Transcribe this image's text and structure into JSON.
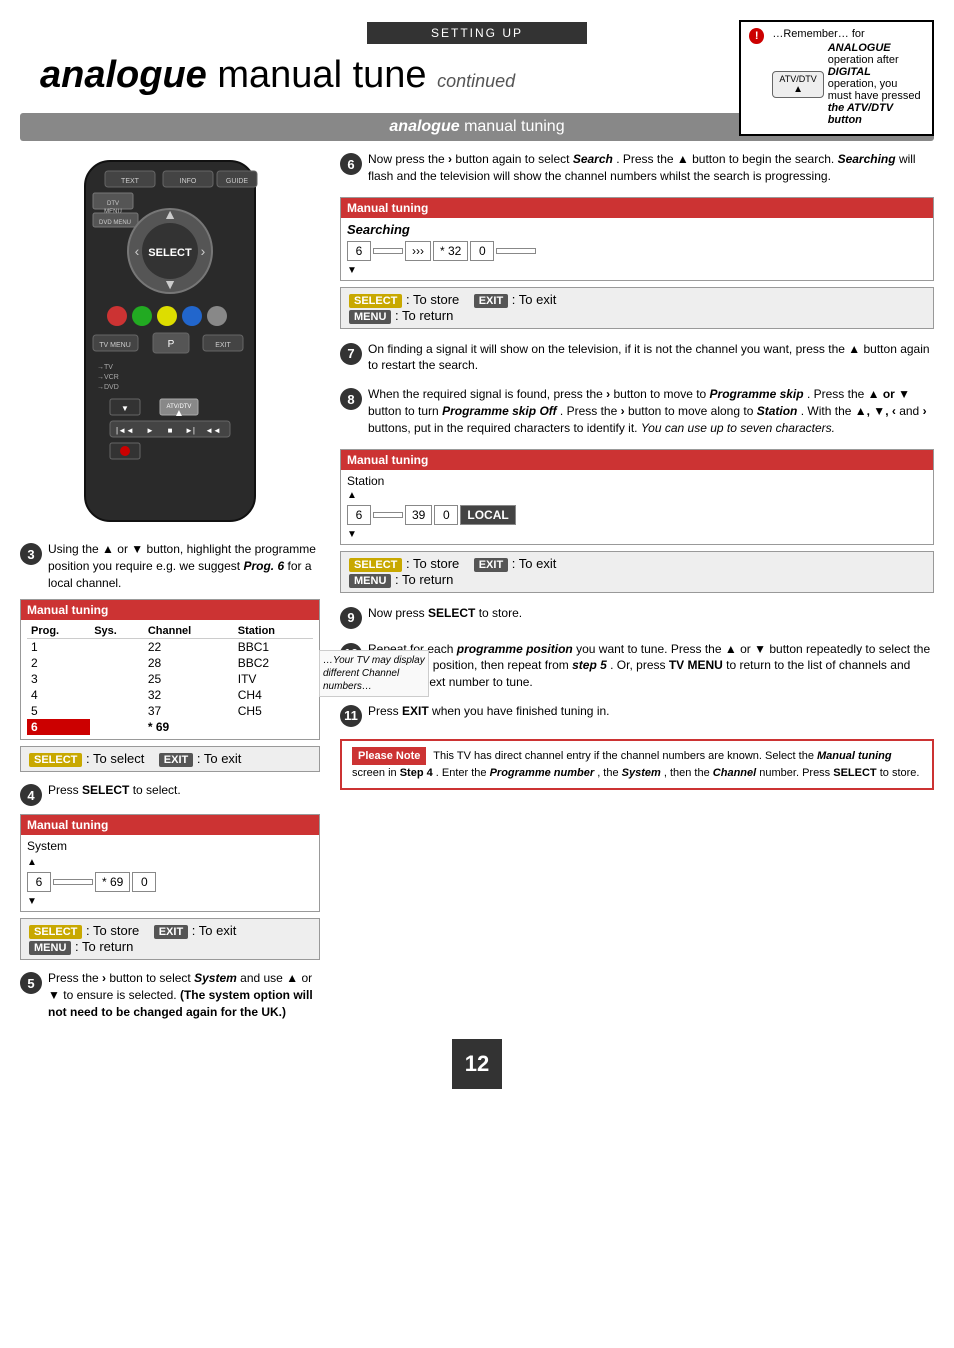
{
  "header": {
    "bar_label": "SETTING UP",
    "title_bold": "analogue",
    "title_regular": " manual tune",
    "title_continued": " continued"
  },
  "remember_box": {
    "exclaim": "!",
    "line1": "…Remember… for",
    "line2": "ANALOGUE",
    "line3": "operation after",
    "line4": "DIGITAL",
    "line5": "operation, you",
    "line6": "must have pressed",
    "line7": "the ATV/DTV button",
    "atv_label": "ATV/DTV",
    "btn_symbol": "▲"
  },
  "section_header": {
    "bold": "analogue",
    "regular": " manual tuning"
  },
  "step3": {
    "number": "3",
    "text": "Using the",
    "up_arrow": "▲",
    "or": " or ",
    "down_arrow": "▼",
    "text2": " button, highlight the programme position you require e.g. we suggest ",
    "prog_bold": "Prog. 6",
    "text3": " for a local channel.",
    "table_header": "Manual tuning",
    "col_prog": "Prog.",
    "col_sys": "Sys.",
    "col_channel": "Channel",
    "col_station": "Station",
    "rows": [
      {
        "prog": "1",
        "sys": "",
        "channel": "22",
        "station": "BBC1"
      },
      {
        "prog": "2",
        "sys": "",
        "channel": "28",
        "station": "BBC2"
      },
      {
        "prog": "3",
        "sys": "",
        "channel": "25",
        "station": "ITV"
      },
      {
        "prog": "4",
        "sys": "",
        "channel": "32",
        "station": "CH4"
      },
      {
        "prog": "5",
        "sys": "",
        "channel": "37",
        "station": "CH5"
      },
      {
        "prog": "6",
        "sys": "",
        "channel": "* 69",
        "station": ""
      }
    ],
    "select_label": "SELECT",
    "select_action": ": To select",
    "exit_label": "EXIT",
    "exit_action": ": To exit",
    "tv_note": "…Your TV may display different Channel numbers…"
  },
  "step4": {
    "number": "4",
    "text": "Press ",
    "select_bold": "SELECT",
    "text2": " to select.",
    "table_header": "Manual tuning",
    "section_label": "System",
    "ch_val1": "6",
    "ch_val2": "* 69",
    "ch_val3": "0",
    "select_label": "SELECT",
    "select_action": ": To store",
    "exit_label": "EXIT",
    "exit_action": ": To exit",
    "menu_label": "MENU",
    "menu_action": ": To return"
  },
  "step5": {
    "number": "5",
    "text1": "Press the ",
    "btn": "›",
    "text2": " button to select ",
    "system_italic": "System",
    "text3": " and use ",
    "up": "▲",
    "text4": " or",
    "down": "▼",
    "text5": " to ensure   is selected. ",
    "bold_note": "(The system option will not need to be changed again for the UK.)"
  },
  "step6": {
    "number": "6",
    "text1": "Now press the ",
    "btn": "›",
    "text2": " button again to select ",
    "search_italic": "Search",
    "text3": ". Press the ",
    "up": "▲",
    "text4": " button to begin the search. ",
    "searching_italic": "Searching",
    "text5": " will flash and the television will show the channel numbers whilst the search is progressing.",
    "table_header": "Manual tuning",
    "searching_label": "Searching",
    "ch_val1": "6",
    "ch_arrows": "›››",
    "ch_star": "* 32",
    "ch_zero": "0",
    "select_label": "SELECT",
    "select_action": ": To store",
    "exit_label": "EXIT",
    "exit_action": ": To exit",
    "menu_label": "MENU",
    "menu_action": ": To return"
  },
  "step7": {
    "number": "7",
    "text1": "On finding a signal it will show on the television, if it is not the channel you want, press the ",
    "up": "▲",
    "text2": " button again to restart the search."
  },
  "step8": {
    "number": "8",
    "text1": "When the required signal is found, press the ",
    "btn": "›",
    "text2": " button to move to ",
    "prog_skip": "Programme skip",
    "text3": ". Press the ",
    "updown": "▲ or ▼",
    "text4": " button to turn ",
    "prog_skip2": "Programme skip",
    "text5": " Off",
    "text6": ". Press the ",
    "btn2": "›",
    "text7": " button to move along to ",
    "station_italic": "Station",
    "text8": ". With the ",
    "arrows": "▲, ▼, ‹",
    "text9": " and ",
    "btn3": "›",
    "text10": " buttons, put in the required characters to identify it. ",
    "italic_note": "You can use up to seven characters.",
    "table_header": "Manual tuning",
    "station_label": "Station",
    "ch_val1": "6",
    "ch_val2": "39",
    "ch_val3": "0",
    "ch_local": "LOCAL",
    "select_label": "SELECT",
    "select_action": ": To store",
    "exit_label": "EXIT",
    "exit_action": ": To exit",
    "menu_label": "MENU",
    "menu_action": ": To return"
  },
  "step9": {
    "number": "9",
    "text": "Now press ",
    "select_bold": "SELECT",
    "text2": " to store."
  },
  "step10": {
    "number": "10",
    "text1": "Repeat for each ",
    "prog_bold": "programme position",
    "text2": " you want to tune. Press the ",
    "up": "▲",
    "text3": " or ",
    "down": "▼",
    "text4": " button repeatedly to select the programme position, then repeat from ",
    "step5_bold": "step 5",
    "text5": ". Or, press ",
    "tv_menu_bold": "TV MENU",
    "text6": " to return to the list of channels and select the next number to tune."
  },
  "step11": {
    "number": "11",
    "text": "Press ",
    "exit_bold": "EXIT",
    "text2": " when you have finished tuning in."
  },
  "please_note": {
    "header": "Please Note",
    "text1": "This TV has direct channel entry if the channel numbers are known. Select the ",
    "manual_italic": "Manual tuning",
    "text2": " screen in ",
    "step4_bold": "Step 4",
    "text3": ". Enter the ",
    "prog_italic": "Programme number",
    "text4": ", the ",
    "sys_italic": "System",
    "text5": ", then the ",
    "ch_italic": "Channel",
    "text6": " number. Press ",
    "select_bold": "SELECT",
    "text7": " to store."
  },
  "page_number": "12"
}
